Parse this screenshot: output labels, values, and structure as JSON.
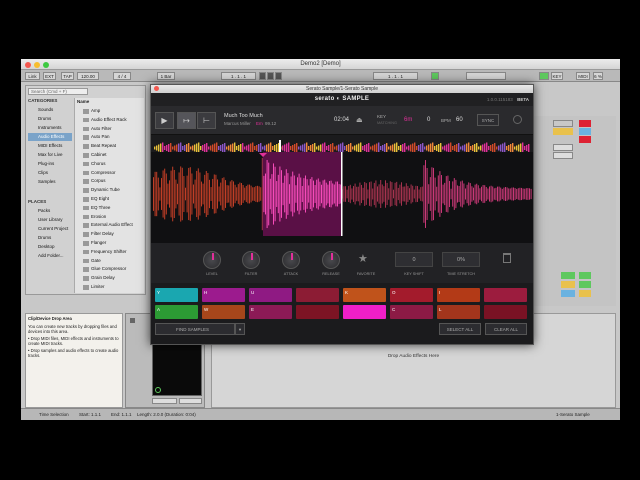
{
  "ableton": {
    "title": "Demo2  [Demo]",
    "toolbar": {
      "link": "Link",
      "ext": "EXT",
      "tap": "TAP",
      "tempo": "120.00",
      "sig": "4 / 4",
      "bar": "1 Bar",
      "pos": "1 . 1 . 1",
      "key": "KEY",
      "midi": "MIDI",
      "cpu": "6 %"
    },
    "browser": {
      "search_placeholder": "Search (Cmd + F)",
      "categories_header": "CATEGORIES",
      "categories": [
        "Sounds",
        "Drums",
        "Instruments",
        "Audio Effects",
        "MIDI Effects",
        "Max for Live",
        "Plug-ins",
        "Clips",
        "Samples"
      ],
      "places_header": "PLACES",
      "places": [
        "Packs",
        "User Library",
        "Current Project",
        "Drums",
        "Desktop",
        "Add Folder..."
      ],
      "name_header": "Name",
      "names": [
        "Amp",
        "Audio Effect Rack",
        "Auto Filter",
        "Auto Pan",
        "Beat Repeat",
        "Cabinet",
        "Chorus",
        "Compressor",
        "Corpus",
        "Dynamic Tube",
        "EQ Eight",
        "EQ Three",
        "Erosion",
        "External Audio Effect",
        "Filter Delay",
        "Flanger",
        "Frequency Shifter",
        "Gate",
        "Glue Compressor",
        "Grain Delay",
        "Limiter"
      ]
    },
    "info": {
      "title": "Clip/Device Drop Area",
      "body": "You can create new tracks by dropping files and devices into this area.",
      "bullets": [
        "Drop MIDI files, MIDI effects and instruments to create MIDI tracks.",
        "Drop samples and audio effects to create audio tracks."
      ]
    },
    "drop_text": "Drop Audio Effects Here",
    "status": {
      "selection": "Time Selection",
      "start": "Start: 1.1.1",
      "end": "End: 1.1.1",
      "length": "Length: 2.0.0  (Duration: 0:04)",
      "track": "1-Serato Sample"
    }
  },
  "serato": {
    "window_title": "Serato Sample/1-Serato Sample",
    "brand": "serato ◐ SAMPLE",
    "version": "1.0.0.115183",
    "beta": "BETA",
    "track_title": "Much Too Much",
    "artist": "Marcus Miller",
    "key_small": "Em",
    "bpm_small": "99.12",
    "time": "02:04",
    "key_label": "KEY",
    "key_sub": "MATCHING",
    "key_value": "6m",
    "key_offset": "0",
    "bpm_label": "BPM",
    "bpm_value": "60",
    "sync": "SYNC",
    "knobs": [
      "LEVEL",
      "FILTER",
      "ATTACK",
      "RELEASE",
      "FAVORITE",
      "KEY SHIFT",
      "TIME STRETCH"
    ],
    "key_shift_value": "0",
    "time_stretch_value": "0%",
    "pads_row1": [
      {
        "label": "Y",
        "color": "#1aa7b0"
      },
      {
        "label": "H",
        "color": "#9c1b8e"
      },
      {
        "label": "U",
        "color": "#8f1a83"
      },
      {
        "label": "",
        "color": "#8c1c34"
      },
      {
        "label": "K",
        "color": "#c0531b"
      },
      {
        "label": "O",
        "color": "#a31b2c"
      },
      {
        "label": "I",
        "color": "#b33a17"
      },
      {
        "label": "",
        "color": "#9c1c3e"
      }
    ],
    "pads_row2": [
      {
        "label": "A",
        "color": "#2c9b34"
      },
      {
        "label": "W",
        "color": "#a7461b"
      },
      {
        "label": "E",
        "color": "#8c1a56"
      },
      {
        "label": "",
        "color": "#7d1424"
      },
      {
        "label": "",
        "color": "#f01fc8"
      },
      {
        "label": "C",
        "color": "#8c1a45"
      },
      {
        "label": "L",
        "color": "#a3351c"
      },
      {
        "label": "",
        "color": "#7a1224"
      }
    ],
    "find_samples": "FIND SAMPLES",
    "select_all": "SELECT ALL",
    "clear_all": "CLEAR ALL",
    "accent": "#e0309a"
  }
}
